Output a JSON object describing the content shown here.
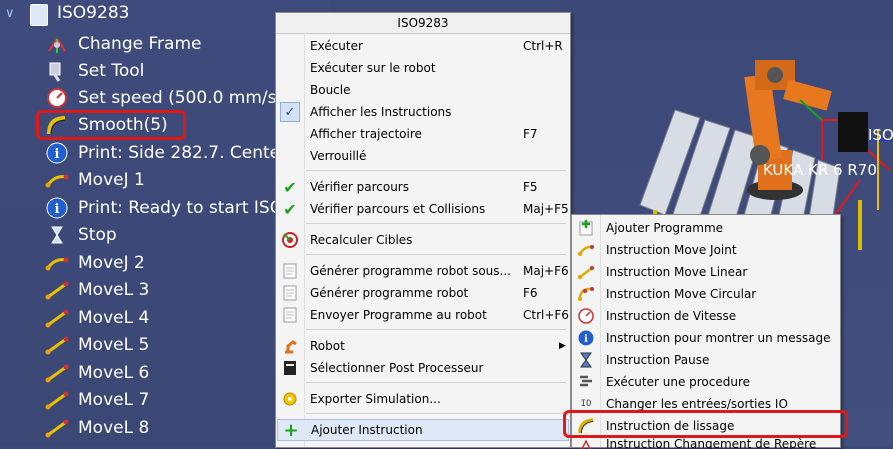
{
  "tree": {
    "program_name": "ISO9283",
    "items": [
      {
        "label": "Change Frame",
        "icon": "change-frame-icon"
      },
      {
        "label": "Set Tool",
        "icon": "set-tool-icon"
      },
      {
        "label": "Set speed (500.0 mm/s)",
        "icon": "speed-gauge-icon"
      },
      {
        "label": "Smooth(5)",
        "icon": "smooth-curve-icon"
      },
      {
        "label": "Print: Side 282.7. Center 4",
        "icon": "info-icon"
      },
      {
        "label": "MoveJ 1",
        "icon": "move-joint-icon"
      },
      {
        "label": "Print: Ready to start ISO S",
        "icon": "info-icon"
      },
      {
        "label": "Stop",
        "icon": "hourglass-icon"
      },
      {
        "label": "MoveJ 2",
        "icon": "move-joint-icon"
      },
      {
        "label": "MoveL 3",
        "icon": "move-linear-icon"
      },
      {
        "label": "MoveL 4",
        "icon": "move-linear-icon"
      },
      {
        "label": "MoveL 5",
        "icon": "move-linear-icon"
      },
      {
        "label": "MoveL 6",
        "icon": "move-linear-icon"
      },
      {
        "label": "MoveL 7",
        "icon": "move-linear-icon"
      },
      {
        "label": "MoveL 8",
        "icon": "move-linear-icon"
      }
    ]
  },
  "viewport": {
    "robot_label": "KUKA KR 6 R70",
    "iso_label": "ISO"
  },
  "context_menu": {
    "title": "ISO9283",
    "items": [
      {
        "label": "Exécuter",
        "shortcut": "Ctrl+R"
      },
      {
        "label": "Exécuter sur le robot",
        "shortcut": ""
      },
      {
        "label": "Boucle",
        "shortcut": ""
      },
      {
        "label": "Afficher les Instructions",
        "shortcut": ""
      },
      {
        "label": "Afficher trajectoire",
        "shortcut": "F7"
      },
      {
        "label": "Verrouillé",
        "shortcut": ""
      },
      {
        "label": "Vérifier parcours",
        "shortcut": "F5"
      },
      {
        "label": "Vérifier parcours et Collisions",
        "shortcut": "Maj+F5"
      },
      {
        "label": "Recalculer Cibles",
        "shortcut": ""
      },
      {
        "label": "Générer programme robot sous...",
        "shortcut": "Maj+F6"
      },
      {
        "label": "Générer programme robot",
        "shortcut": "F6"
      },
      {
        "label": "Envoyer Programme au robot",
        "shortcut": "Ctrl+F6"
      },
      {
        "label": "Robot",
        "shortcut": ""
      },
      {
        "label": "Sélectionner Post Processeur",
        "shortcut": ""
      },
      {
        "label": "Exporter Simulation...",
        "shortcut": ""
      },
      {
        "label": "Ajouter Instruction",
        "shortcut": ""
      }
    ]
  },
  "submenu": {
    "items": [
      {
        "label": "Ajouter Programme"
      },
      {
        "label": "Instruction Move Joint"
      },
      {
        "label": "Instruction Move Linear"
      },
      {
        "label": "Instruction Move Circular"
      },
      {
        "label": "Instruction de Vitesse"
      },
      {
        "label": "Instruction pour montrer un message"
      },
      {
        "label": "Instruction Pause"
      },
      {
        "label": "Exécuter une procedure"
      },
      {
        "label": "Changer les entrées/sorties IO"
      },
      {
        "label": "Instruction de lissage"
      },
      {
        "label": "Instruction Changement de Repère"
      }
    ]
  },
  "colors": {
    "highlight": "#e01818",
    "tree_bg": "#3d4a78",
    "check": "#1aa31a"
  }
}
